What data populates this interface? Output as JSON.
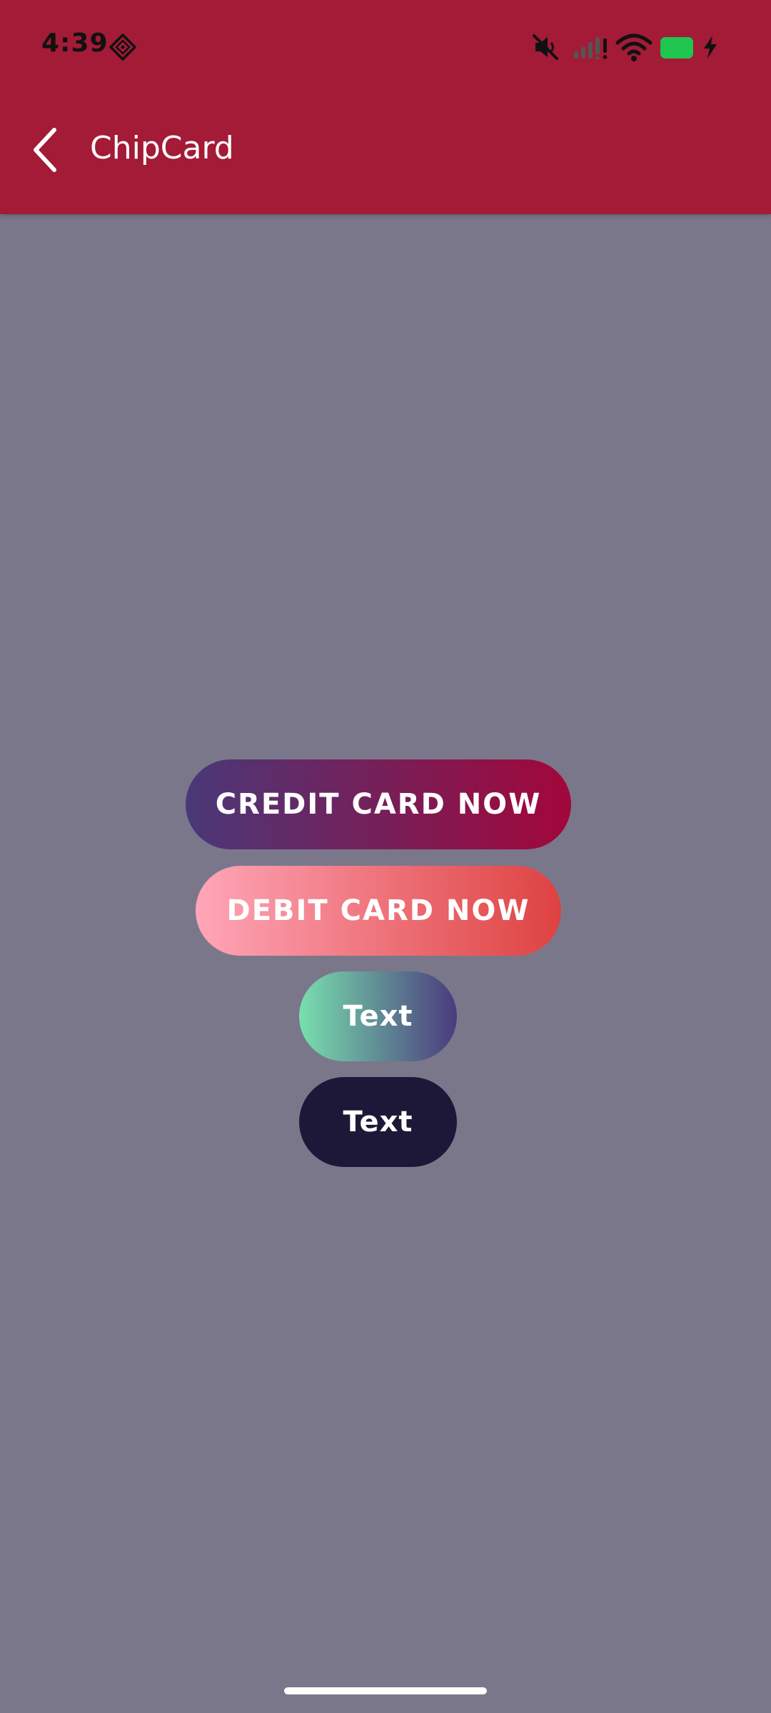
{
  "status_bar": {
    "time": "4:39",
    "icons": [
      "diamond-app-icon",
      "mute-icon",
      "signal-icon",
      "wifi-icon",
      "battery-icon",
      "charging-bolt-icon"
    ],
    "battery_color": "#1fc64f"
  },
  "toolbar": {
    "title": "ChipCard",
    "back_icon": "chevron-left-icon",
    "background": "#a31b36"
  },
  "chips": [
    {
      "label": "CREDIT CARD NOW",
      "gradient": [
        "#4a3878",
        "#a2073a"
      ]
    },
    {
      "label": "DEBIT CARD NOW",
      "gradient": [
        "#ffa6b8",
        "#de4240"
      ]
    },
    {
      "label": "Text",
      "gradient": [
        "#78dfae",
        "#4a3b7d"
      ]
    },
    {
      "label": "Text",
      "color": "#1e1838"
    }
  ],
  "colors": {
    "page_background": "#7b778b",
    "chip_text": "#ffffff"
  }
}
